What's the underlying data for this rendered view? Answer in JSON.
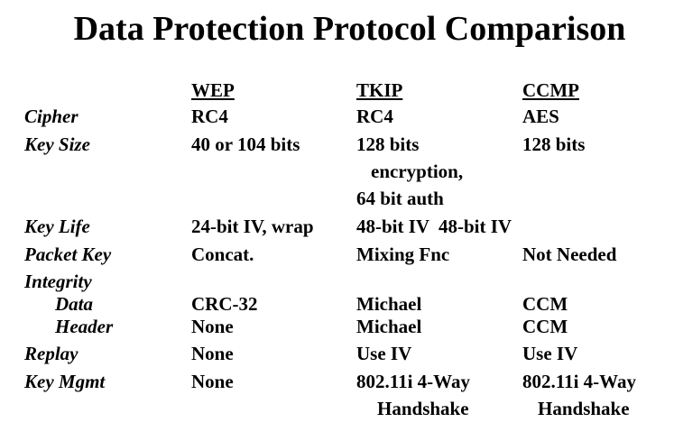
{
  "title": "Data Protection Protocol Comparison",
  "columns": [
    "WEP",
    "TKIP",
    "CCMP"
  ],
  "rows": {
    "cipher": {
      "label": "Cipher",
      "wep": "RC4",
      "tkip": "RC4",
      "ccmp": "AES"
    },
    "key_size": {
      "label": "Key Size",
      "wep": "40 or 104 bits",
      "tkip_lines": [
        "128 bits",
        "encryption,",
        "64 bit auth"
      ],
      "ccmp": "128 bits"
    },
    "key_life": {
      "label": "Key Life",
      "wep": "24-bit IV, wrap",
      "tkip": "48-bit IV",
      "ccmp": "48-bit IV"
    },
    "packet_key": {
      "label": "Packet Key",
      "wep": "Concat.",
      "tkip": "Mixing Fnc",
      "ccmp": "Not Needed"
    },
    "integrity": {
      "label": "Integrity"
    },
    "data": {
      "label": "Data",
      "wep": "CRC-32",
      "tkip": "Michael",
      "ccmp": "CCM"
    },
    "header": {
      "label": "Header",
      "wep": "None",
      "tkip": "Michael",
      "ccmp": "CCM"
    },
    "replay": {
      "label": "Replay",
      "wep": "None",
      "tkip": "Use IV",
      "ccmp": "Use IV"
    },
    "key_mgmt": {
      "label": "Key Mgmt",
      "wep": "None",
      "tkip_lines": [
        "802.11i 4-Way",
        "Handshake"
      ],
      "ccmp_lines": [
        "802.11i 4-Way",
        "Handshake"
      ]
    }
  }
}
